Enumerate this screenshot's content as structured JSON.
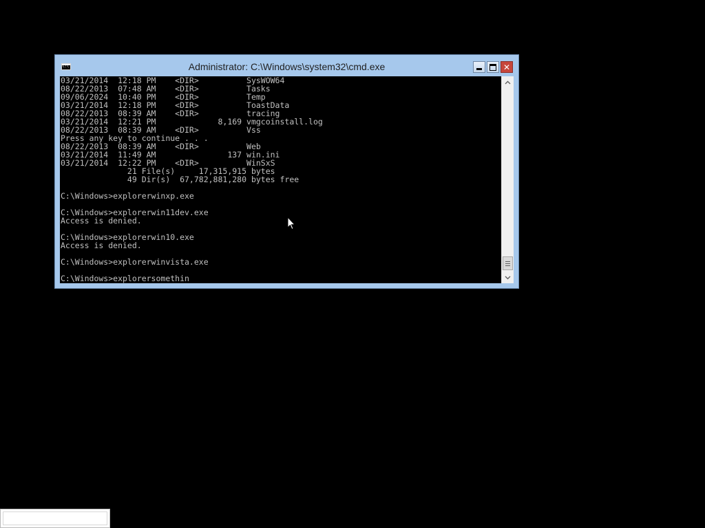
{
  "window": {
    "title": "Administrator: C:\\Windows\\system32\\cmd.exe",
    "icon": "cmd-icon",
    "controls": [
      "minimize-icon",
      "maximize-icon",
      "close-icon"
    ]
  },
  "console": {
    "lines": [
      "03/21/2014  12:18 PM    <DIR>          SysWOW64",
      "08/22/2013  07:48 AM    <DIR>          Tasks",
      "09/06/2024  10:40 PM    <DIR>          Temp",
      "03/21/2014  12:18 PM    <DIR>          ToastData",
      "08/22/2013  08:39 AM    <DIR>          tracing",
      "03/21/2014  12:21 PM             8,169 vmgcoinstall.log",
      "08/22/2013  08:39 AM    <DIR>          Vss",
      "Press any key to continue . . .",
      "08/22/2013  08:39 AM    <DIR>          Web",
      "03/21/2014  11:49 AM               137 win.ini",
      "03/21/2014  12:22 PM    <DIR>          WinSxS",
      "              21 File(s)     17,315,915 bytes",
      "              49 Dir(s)  67,782,881,280 bytes free",
      "",
      "C:\\Windows>explorerwinxp.exe",
      "",
      "C:\\Windows>explorerwin11dev.exe",
      "Access is denied.",
      "",
      "C:\\Windows>explorerwin10.exe",
      "Access is denied.",
      "",
      "C:\\Windows>explorerwinvista.exe",
      "",
      "C:\\Windows>explorersomethin"
    ]
  },
  "colors": {
    "console_bg": "#000000",
    "console_text": "#c0c0c0",
    "frame": "#a6c8ec",
    "close_button": "#c7463c"
  }
}
